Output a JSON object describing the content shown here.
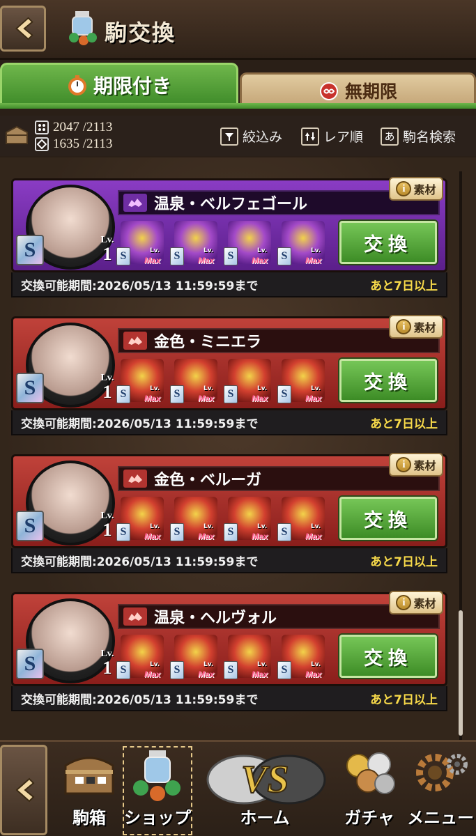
{
  "header": {
    "title": "駒交換"
  },
  "tabs": [
    {
      "label": "期限付き",
      "active": true
    },
    {
      "label": "無期限",
      "active": false
    }
  ],
  "resources": {
    "row1": "2047 /2113",
    "row2": "1635 /2113"
  },
  "controls": {
    "filter": "絞込み",
    "sort": "レア順",
    "search_icon_glyph": "あ",
    "search": "駒名検索"
  },
  "cards": [
    {
      "theme": "purple",
      "name": "温泉・ベルフェゴール",
      "badge": "素材",
      "rank": "S",
      "lv_label": "Lv.",
      "level": "1",
      "exchange_label": "交換",
      "period": "交換可能期間:2026/05/13 11:59:59まで",
      "remaining": "あと7日以上"
    },
    {
      "theme": "red",
      "name": "金色・ミニエラ",
      "badge": "素材",
      "rank": "S",
      "lv_label": "Lv.",
      "level": "1",
      "exchange_label": "交換",
      "period": "交換可能期間:2026/05/13 11:59:59まで",
      "remaining": "あと7日以上"
    },
    {
      "theme": "red",
      "name": "金色・ベルーガ",
      "badge": "素材",
      "rank": "S",
      "lv_label": "Lv.",
      "level": "1",
      "exchange_label": "交換",
      "period": "交換可能期間:2026/05/13 11:59:59まで",
      "remaining": "あと7日以上"
    },
    {
      "theme": "red",
      "name": "温泉・ヘルヴォル",
      "badge": "素材",
      "rank": "S",
      "lv_label": "Lv.",
      "level": "1",
      "exchange_label": "交換",
      "period": "交換可能期間:2026/05/13 11:59:59まで",
      "remaining": "あと7日以上"
    }
  ],
  "material": {
    "rank": "S",
    "lv_label": "Lv.",
    "max_label": "Max"
  },
  "nav": {
    "box": "駒箱",
    "shop": "ショップ",
    "home": "ホーム",
    "vs_logo": "VS",
    "gacha": "ガチャ",
    "menu": "メニュー"
  },
  "colors": {
    "accent_green": "#4f9e33",
    "purple_card": "#7a34b0",
    "red_card": "#b8352f",
    "remaining_yellow": "#f7d94a"
  }
}
